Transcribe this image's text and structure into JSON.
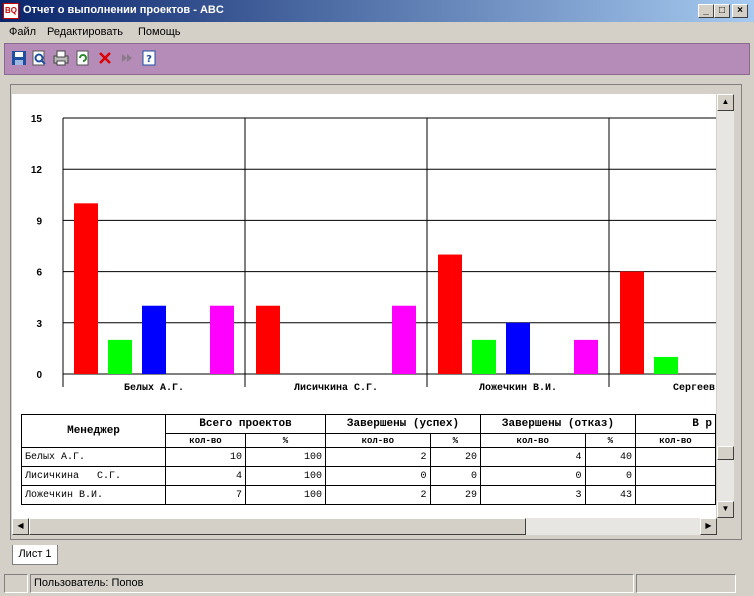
{
  "window": {
    "title": "Отчет о выполнении проектов - ABC",
    "icon_label": "BQ"
  },
  "menu": {
    "items": [
      "Файл",
      "Редактировать",
      "Помощь"
    ]
  },
  "toolbar": {
    "icons": [
      "save-icon",
      "preview-icon",
      "print-icon",
      "refresh-icon",
      "delete-icon",
      "forward-icon",
      "help-icon"
    ]
  },
  "chart_data": {
    "type": "bar",
    "categories": [
      "Белых А.Г.",
      "Лисичкина  С.Г.",
      "Ложечкин В.И.",
      "Сергеев К"
    ],
    "ylim": [
      0,
      15
    ],
    "yticks": [
      "0",
      "3",
      "6",
      "9",
      "12",
      "15"
    ],
    "grid": true,
    "series": [
      {
        "color": "#ff0000",
        "values": [
          10,
          4,
          7,
          6
        ]
      },
      {
        "color": "#00ff00",
        "values": [
          2,
          0,
          2,
          1
        ]
      },
      {
        "color": "#0000ff",
        "values": [
          4,
          0,
          3,
          0
        ]
      },
      {
        "color": "#ffff00",
        "values": [
          0,
          0,
          0,
          0
        ]
      },
      {
        "color": "#ff00ff",
        "values": [
          4,
          4,
          2,
          0
        ]
      }
    ]
  },
  "table": {
    "headers": {
      "manager": "Менеджер",
      "groups": [
        "Всего проектов",
        "Завершены (успех)",
        "Завершены (отказ)",
        "В р"
      ],
      "sub_count": "кол-во",
      "sub_pct": "%"
    },
    "rows": [
      {
        "name": "Белых А.Г.",
        "values": [
          "10",
          "100",
          "2",
          "20",
          "4",
          "40"
        ]
      },
      {
        "name": "Лисичкина   С.Г.",
        "values": [
          "4",
          "100",
          "0",
          "0",
          "0",
          "0"
        ]
      },
      {
        "name": "Ложечкин В.И.",
        "values": [
          "7",
          "100",
          "2",
          "29",
          "3",
          "43"
        ]
      }
    ]
  },
  "tabs": {
    "sheet1": "Лист 1"
  },
  "status": {
    "user": "Пользователь: Попов"
  }
}
